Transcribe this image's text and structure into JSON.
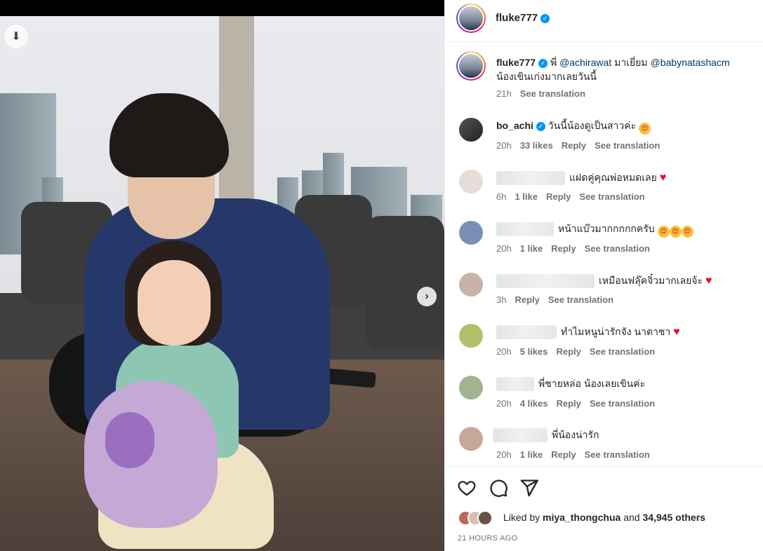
{
  "post": {
    "author": "fluke777",
    "verified_mark": "✓",
    "photo_counter_icon": "⬇",
    "next_icon": "›"
  },
  "caption": {
    "author": "fluke777",
    "prefix": "พี่",
    "mention1": "@achirawat",
    "middle": "มาเยี่ยม",
    "mention2": "@babynatashacm",
    "line2": "น้องเขินเก่งมากเลยวันนี้",
    "time": "21h",
    "see_translation": "See translation"
  },
  "comments": [
    {
      "user": "bo_achi",
      "verified": true,
      "text": "วันนี้น้องดูเป็นสาวค่ะ",
      "emoji": "😍",
      "time": "20h",
      "likes": "33 likes",
      "reply": "Reply",
      "see_translation": "See translation"
    },
    {
      "user": "",
      "verified": false,
      "text": "แฝดคู่คุณพ่อหมดเลย",
      "emoji": "♥",
      "time": "6h",
      "likes": "1 like",
      "reply": "Reply",
      "see_translation": "See translation"
    },
    {
      "user": "",
      "verified": false,
      "text": "หน้าแบ๊วมากกกกกครับ",
      "emoji": "😍😍😍",
      "time": "20h",
      "likes": "1 like",
      "reply": "Reply",
      "see_translation": "See translation"
    },
    {
      "user": "",
      "verified": false,
      "text": "เหมือนฟลุ๊คจิ๋วมากเลยจ้ะ",
      "emoji": "♥",
      "time": "3h",
      "likes": "",
      "reply": "Reply",
      "see_translation": "See translation"
    },
    {
      "user": "",
      "verified": false,
      "text": "ทำไมหนูน่ารักจัง นาตาชา",
      "emoji": "♥",
      "time": "20h",
      "likes": "5 likes",
      "reply": "Reply",
      "see_translation": "See translation"
    },
    {
      "user": "",
      "verified": false,
      "text": "พี่ชายหล่อ น้องเลยเขินค่ะ",
      "emoji": "",
      "time": "20h",
      "likes": "4 likes",
      "reply": "Reply",
      "see_translation": "See translation"
    },
    {
      "user": "",
      "verified": false,
      "text": "พี่น้องน่ารัก",
      "emoji": "",
      "time": "20h",
      "likes": "1 like",
      "reply": "Reply",
      "see_translation": "See translation"
    }
  ],
  "likes_row": {
    "prefix": "Liked by",
    "user": "miya_thongchua",
    "and": "and",
    "others": "34,945 others"
  },
  "post_time": "21 HOURS AGO",
  "icons": [
    "heart-icon",
    "comment-icon",
    "share-icon"
  ],
  "colors": {
    "verified": "#0095f6",
    "link": "#00376b",
    "meta": "#737373"
  }
}
